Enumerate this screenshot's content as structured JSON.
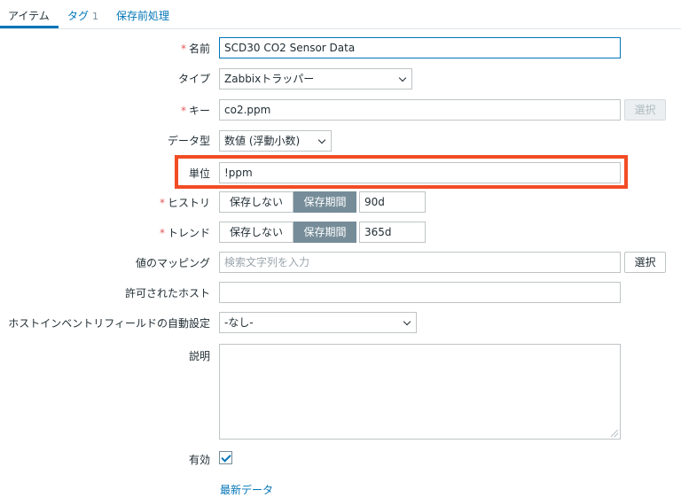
{
  "tabs": [
    {
      "label": "アイテム",
      "active": true
    },
    {
      "label": "タグ",
      "count": "1"
    },
    {
      "label": "保存前処理"
    }
  ],
  "form": {
    "name": {
      "label": "名前",
      "required": "*",
      "value": "SCD30 CO2 Sensor Data"
    },
    "type": {
      "label": "タイプ",
      "value": "Zabbixトラッパー"
    },
    "key": {
      "label": "キー",
      "required": "*",
      "value": "co2.ppm",
      "select_button": "選択"
    },
    "data_type": {
      "label": "データ型",
      "value": "数値 (浮動小数)"
    },
    "units": {
      "label": "単位",
      "value": "!ppm"
    },
    "history": {
      "label": "ヒストリ",
      "required": "*",
      "options": [
        "保存しない",
        "保存期間"
      ],
      "selected": "保存期間",
      "value": "90d"
    },
    "trends": {
      "label": "トレンド",
      "required": "*",
      "options": [
        "保存しない",
        "保存期間"
      ],
      "selected": "保存期間",
      "value": "365d"
    },
    "value_mapping": {
      "label": "値のマッピング",
      "placeholder": "検索文字列を入力",
      "select_button": "選択"
    },
    "allowed_hosts": {
      "label": "許可されたホスト",
      "value": ""
    },
    "inventory": {
      "label": "ホストインベントリフィールドの自動設定",
      "value": "-なし-"
    },
    "description": {
      "label": "説明",
      "value": ""
    },
    "enabled": {
      "label": "有効",
      "checked": true
    },
    "latest_data_link": "最新データ"
  },
  "colors": {
    "accent": "#0275b8",
    "highlight": "#f24c25",
    "required": "#e45959"
  }
}
